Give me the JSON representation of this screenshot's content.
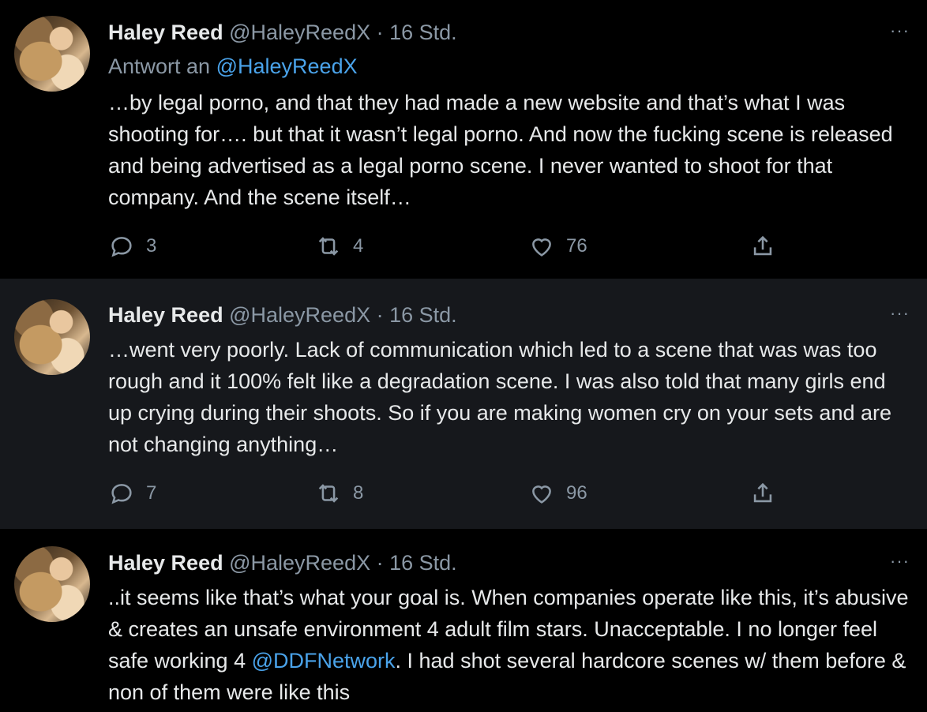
{
  "tweets": [
    {
      "name": "Haley Reed",
      "handle": "@HaleyReedX",
      "separator": "·",
      "time": "16 Std.",
      "reply_prefix": "Antwort an",
      "reply_to": "@HaleyReedX",
      "text": "…by legal porno, and that they had made a new website and that’s what I was shooting for…. but that it wasn’t legal porno. And now the fucking scene is released and being advertised as a legal porno scene. I never wanted to shoot for that company. And the scene itself…",
      "replies": "3",
      "retweets": "4",
      "likes": "76"
    },
    {
      "name": "Haley Reed",
      "handle": "@HaleyReedX",
      "separator": "·",
      "time": "16 Std.",
      "text": "…went very poorly. Lack of communication which led to a scene that was was too rough and it 100% felt like a degradation scene. I was also told that many girls end up crying during their shoots. So if you are making women cry on your sets and are not changing anything…",
      "replies": "7",
      "retweets": "8",
      "likes": "96"
    },
    {
      "name": "Haley Reed",
      "handle": "@HaleyReedX",
      "separator": "·",
      "time": "16 Std.",
      "text_before": "..it seems like that’s what your goal is. When companies operate like this, it’s abusive & creates an unsafe environment 4 adult film stars. Unacceptable. I no longer feel safe working 4 ",
      "mention": "@DDFNetwork",
      "text_after": ". I had shot several hardcore scenes w/ them before & non of them were like this"
    }
  ],
  "more_icon": "···",
  "icons": {
    "reply": "speech-bubble",
    "retweet": "retweet-arrows",
    "like": "heart",
    "share": "share-upload"
  },
  "colors": {
    "background": "#000000",
    "highlight_background": "#16181c",
    "link": "#4aa3ea",
    "secondary_text": "#8b98a5"
  }
}
